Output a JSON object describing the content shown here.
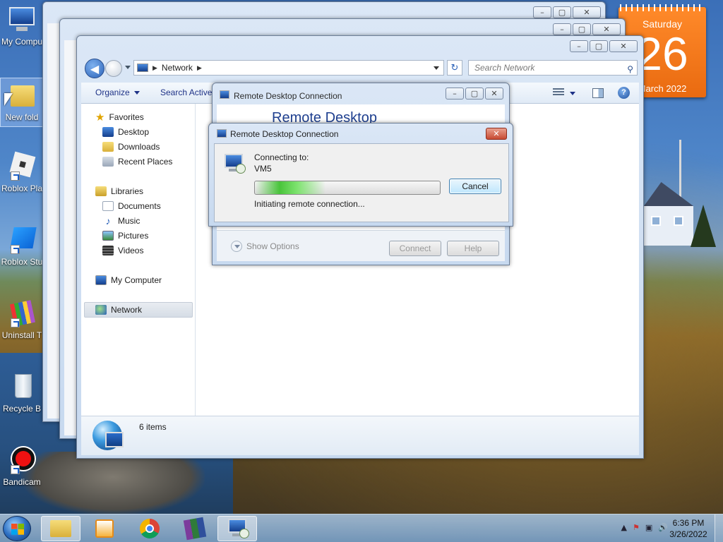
{
  "desktop": {
    "icons": [
      {
        "label": "My Compu"
      },
      {
        "label": "New fold"
      },
      {
        "label": "Roblox Pla"
      },
      {
        "label": "Roblox Stu"
      },
      {
        "label": "Uninstall T"
      },
      {
        "label": "Recycle B"
      },
      {
        "label": "Bandicam"
      }
    ]
  },
  "calendar": {
    "day_of_week": "Saturday",
    "day": "26",
    "month_year": "March 2022"
  },
  "explorer": {
    "address": {
      "location": "Network"
    },
    "search_placeholder": "Search Network",
    "toolbar": {
      "organize": "Organize",
      "search_ad": "Search Active"
    },
    "nav": {
      "favorites": "Favorites",
      "desktop": "Desktop",
      "downloads": "Downloads",
      "recent": "Recent Places",
      "libraries": "Libraries",
      "documents": "Documents",
      "music": "Music",
      "pictures": "Pictures",
      "videos": "Videos",
      "computer": "My Computer",
      "network": "Network"
    },
    "status": {
      "count": "6 items"
    }
  },
  "rdc_back": {
    "title": "Remote Desktop Connection",
    "heading": "Remote Desktop",
    "show_options": "Show Options",
    "connect": "Connect",
    "help": "Help"
  },
  "rdc_front": {
    "title": "Remote Desktop Connection",
    "connecting_to_label": "Connecting to:",
    "host": "VM5",
    "status": "Initiating remote connection...",
    "cancel": "Cancel",
    "progress_fraction": 0.38,
    "progress_color": "#49c43b"
  },
  "taskbar": {
    "time": "6:36 PM",
    "date": "3/26/2022",
    "active_app": "Remote Desktop Connection"
  }
}
